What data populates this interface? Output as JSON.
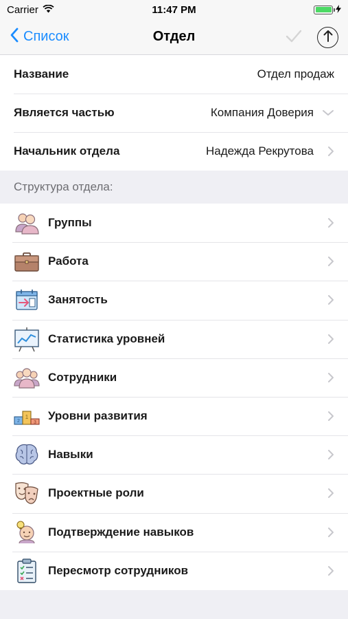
{
  "status": {
    "carrier": "Carrier",
    "time": "11:47 PM"
  },
  "nav": {
    "back_label": "Список",
    "title": "Отдел"
  },
  "fields": [
    {
      "label": "Название",
      "value": "Отдел продаж"
    },
    {
      "label": "Является частью",
      "value": "Компания Доверия"
    },
    {
      "label": "Начальник отдела",
      "value": "Надежда Рекрутова"
    }
  ],
  "section": {
    "header": "Структура отдела:"
  },
  "menu": [
    {
      "label": "Группы",
      "icon": "group-icon"
    },
    {
      "label": "Работа",
      "icon": "briefcase-icon"
    },
    {
      "label": "Занятость",
      "icon": "calendar-icon"
    },
    {
      "label": "Статистика уровней",
      "icon": "chart-board-icon"
    },
    {
      "label": "Сотрудники",
      "icon": "employees-icon"
    },
    {
      "label": "Уровни развития",
      "icon": "podium-icon"
    },
    {
      "label": "Навыки",
      "icon": "brain-icon"
    },
    {
      "label": "Проектные роли",
      "icon": "theater-masks-icon"
    },
    {
      "label": "Подтверждение навыков",
      "icon": "idea-person-icon"
    },
    {
      "label": "Пересмотр сотрудников",
      "icon": "clipboard-icon"
    }
  ],
  "colors": {
    "accent": "#1a8cff",
    "battery": "#4cd964",
    "background": "#efeff4"
  }
}
